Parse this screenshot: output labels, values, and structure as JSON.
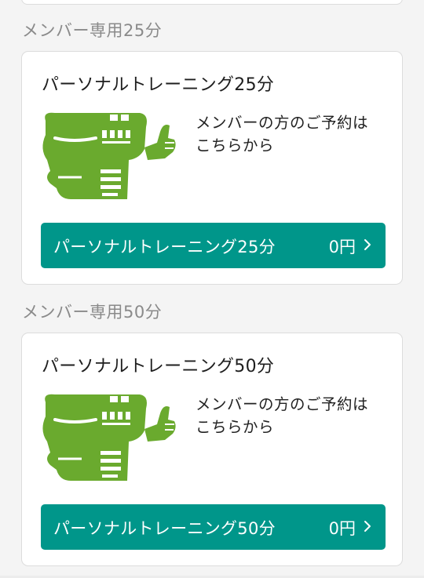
{
  "sections": [
    {
      "label": "メンバー専用25分",
      "card": {
        "title": "パーソナルトレーニング25分",
        "description": "メンバーの方のご予約は\nこちらから",
        "button_label": "パーソナルトレーニング25分",
        "price": "0円"
      }
    },
    {
      "label": "メンバー専用50分",
      "card": {
        "title": "パーソナルトレーニング50分",
        "description": "メンバーの方のご予約は\nこちらから",
        "button_label": "パーソナルトレーニング50分",
        "price": "0円"
      }
    }
  ],
  "colors": {
    "accent_button": "#00968a",
    "mascot_green": "#6aaa2e",
    "section_label": "#8a8a8a"
  },
  "icons": {
    "mascot": "half-frog-half-skeleton-thumbs-up",
    "button_chevron": "chevron-right-icon"
  }
}
